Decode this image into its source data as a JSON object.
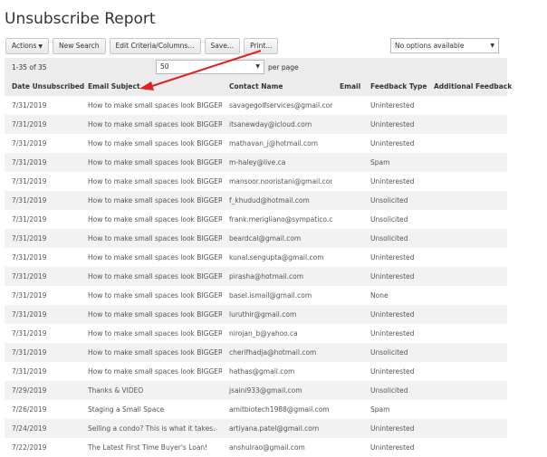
{
  "page": {
    "title": "Unsubscribe Report"
  },
  "toolbar": {
    "actions_label": "Actions",
    "new_search_label": "New Search",
    "edit_criteria_label": "Edit Criteria/Columns...",
    "save_label": "Save...",
    "print_label": "Print..."
  },
  "options_select": {
    "value": "No options available"
  },
  "pager": {
    "range": "1-35 of 35",
    "page_size": "50",
    "per_page_label": "per page"
  },
  "annotation": {
    "color": "#e02020"
  },
  "table": {
    "columns": [
      "Date Unsubscribed",
      "Email Subject",
      "Contact Name",
      "Email",
      "Feedback Type",
      "Additional Feedback"
    ],
    "rows": [
      [
        "7/31/2019",
        "How to make small spaces look BIGGER!",
        "savagegolfservices@gmail.com",
        "",
        "Uninterested",
        ""
      ],
      [
        "7/31/2019",
        "How to make small spaces look BIGGER!",
        "itsanewday@icloud.com",
        "",
        "Uninterested",
        ""
      ],
      [
        "7/31/2019",
        "How to make small spaces look BIGGER!",
        "mathavan_j@hotmail.com",
        "",
        "Uninterested",
        ""
      ],
      [
        "7/31/2019",
        "How to make small spaces look BIGGER!",
        "m-haley@live.ca",
        "",
        "Spam",
        ""
      ],
      [
        "7/31/2019",
        "How to make small spaces look BIGGER!",
        "mansoor.nooristani@gmail.com",
        "",
        "Uninterested",
        ""
      ],
      [
        "7/31/2019",
        "How to make small spaces look BIGGER!",
        "f_khudud@hotmail.com",
        "",
        "Unsolicited",
        ""
      ],
      [
        "7/31/2019",
        "How to make small spaces look BIGGER!",
        "frank.merigliano@sympatico.ca",
        "",
        "Unsolicited",
        ""
      ],
      [
        "7/31/2019",
        "How to make small spaces look BIGGER!",
        "beardcal@gmail.com",
        "",
        "Unsolicited",
        ""
      ],
      [
        "7/31/2019",
        "How to make small spaces look BIGGER!",
        "kunal.sengupta@gmail.com",
        "",
        "Uninterested",
        ""
      ],
      [
        "7/31/2019",
        "How to make small spaces look BIGGER!",
        "pirasha@hotmail.com",
        "",
        "Uninterested",
        ""
      ],
      [
        "7/31/2019",
        "How to make small spaces look BIGGER!",
        "basel.ismail@gmail.com",
        "",
        "None",
        ""
      ],
      [
        "7/31/2019",
        "How to make small spaces look BIGGER!",
        "luruthir@gmail.com",
        "",
        "Uninterested",
        ""
      ],
      [
        "7/31/2019",
        "How to make small spaces look BIGGER!",
        "nirojan_b@yahoo.ca",
        "",
        "Uninterested",
        ""
      ],
      [
        "7/31/2019",
        "How to make small spaces look BIGGER!",
        "cherifhadja@hotmail.com",
        "",
        "Unsolicited",
        ""
      ],
      [
        "7/31/2019",
        "How to make small spaces look BIGGER!",
        "hathas@gmail.com",
        "",
        "Uninterested",
        ""
      ],
      [
        "7/29/2019",
        "Thanks & VIDEO",
        "jsaini933@gmail.com",
        "",
        "Unsolicited",
        ""
      ],
      [
        "7/26/2019",
        "Staging a Small Space",
        "amitbiotech1988@gmail.com",
        "",
        "Spam",
        ""
      ],
      [
        "7/24/2019",
        "Selling a condo? This is what it takes.",
        "artiyana.patel@gmail.com",
        "",
        "Uninterested",
        ""
      ],
      [
        "7/22/2019",
        "The Latest First Time Buyer's Loan!",
        "anshulrao@gmail.com",
        "",
        "Uninterested",
        ""
      ]
    ]
  }
}
